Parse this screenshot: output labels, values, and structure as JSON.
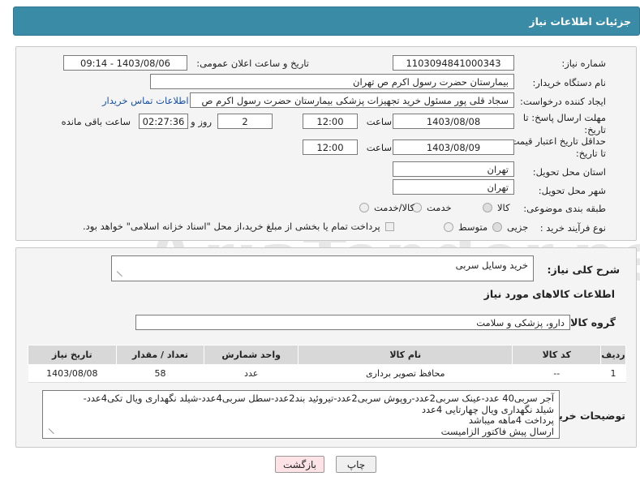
{
  "header": {
    "title": "جزئیات اطلاعات نیاز"
  },
  "fields": {
    "need_number_label": "شماره نیاز:",
    "need_number": "1103094841000343",
    "announce_label": "تاریخ و ساعت اعلان عمومی:",
    "announce_value": "1403/08/06 - 09:14",
    "buyer_org_label": "نام دستگاه خریدار:",
    "buyer_org": "بیمارستان حضرت رسول اکرم ص  تهران",
    "creator_label": "ایجاد کننده درخواست:",
    "creator": "سجاد قلی پور مسئول خرید تجهیزات پزشکی  بیمارستان حضرت رسول اکرم ص",
    "contact_link": "اطلاعات تماس خریدار",
    "reply_deadline_label": "مهلت ارسال پاسخ: تا تاریخ:",
    "reply_date": "1403/08/08",
    "time_label": "ساعت",
    "reply_time": "12:00",
    "days_value": "2",
    "days_label": "روز و",
    "remaining_time": "02:27:36",
    "remaining_label": "ساعت باقی مانده",
    "validity_label": "حداقل تاریخ اعتبار قیمت: تا تاریخ:",
    "validity_date": "1403/08/09",
    "validity_time": "12:00",
    "province_label": "استان محل تحویل:",
    "province": "تهران",
    "city_label": "شهر محل تحویل:",
    "city": "تهران",
    "category_label": "طبقه بندی موضوعی:",
    "category_options": [
      "کالا",
      "خدمت",
      "کالا/خدمت"
    ],
    "process_label": "نوع فرآیند خرید :",
    "process_options": [
      "جزیی",
      "متوسط"
    ],
    "payment_note": "پرداخت تمام یا بخشی از مبلغ خرید،از محل \"اسناد خزانه اسلامی\" خواهد بود."
  },
  "description": {
    "label": "شرح کلی نیاز:",
    "value": "خرید وسایل سربی"
  },
  "goods_info": {
    "title": "اطلاعات کالاهای مورد نیاز"
  },
  "goods_group": {
    "label": "گروه کالا:",
    "value": "دارو، پزشکی و سلامت"
  },
  "table": {
    "columns": [
      "ردیف",
      "کد کالا",
      "نام کالا",
      "واحد شمارش",
      "تعداد / مقدار",
      "تاریخ نیاز"
    ],
    "rows": [
      [
        "1",
        "--",
        "محافظ تصویر برداری",
        "عدد",
        "58",
        "1403/08/08"
      ]
    ]
  },
  "buyer_notes": {
    "label": "توضیحات خریدار:",
    "lines": [
      "آجر سربی40 عدد-عینک سربی2عدد-روپوش سربی2عدد-تیروئید بند2عدد-سطل سربی4عدد-شیلد نگهداری ویال تکی4عدد-",
      "شیلد نگهداری ویال چهارتایی 4عدد",
      "پرداخت 4ماهه میباشد",
      "ارسال پیش فاکتور الزامیست"
    ]
  },
  "buttons": {
    "print": "چاپ",
    "back": "بازگشت"
  },
  "watermark": {
    "text": "AriaTender.net"
  }
}
